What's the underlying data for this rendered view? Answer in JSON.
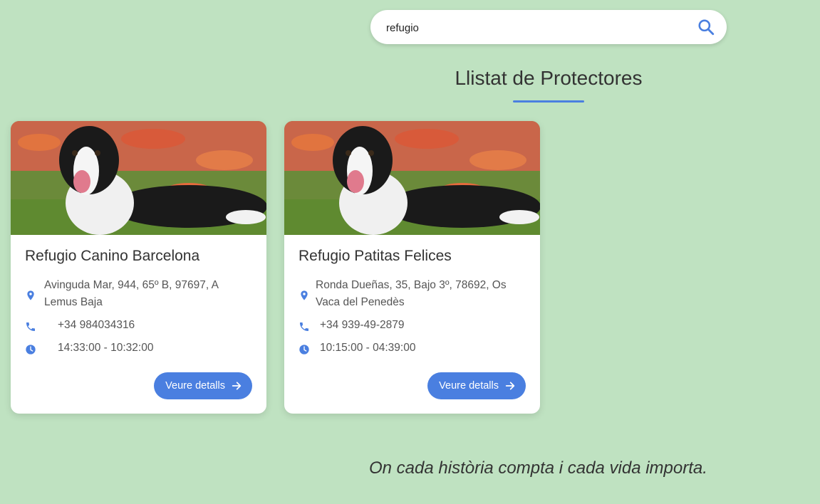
{
  "search": {
    "value": "refugio",
    "placeholder": ""
  },
  "page_title": "Llistat de Protectores",
  "cards": [
    {
      "name": "Refugio Canino Barcelona",
      "address": "Avinguda Mar, 944, 65º B, 97697, A Lemus Baja",
      "phone": "+34 984034316",
      "hours": "14:33:00 - 10:32:00",
      "button_label": "Veure detalls"
    },
    {
      "name": "Refugio Patitas Felices",
      "address": "Ronda Dueñas, 35, Bajo 3º, 78692, Os Vaca del Penedès",
      "phone": "+34 939-49-2879",
      "hours": "10:15:00 - 04:39:00",
      "button_label": "Veure detalls"
    }
  ],
  "footer_quote": "On cada història compta i cada vida importa.",
  "colors": {
    "background": "#bfe2c1",
    "accent": "#4a7fe0",
    "card": "#ffffff"
  },
  "icons": [
    "search-icon",
    "map-pin-icon",
    "phone-icon",
    "clock-icon",
    "arrow-right-icon"
  ]
}
